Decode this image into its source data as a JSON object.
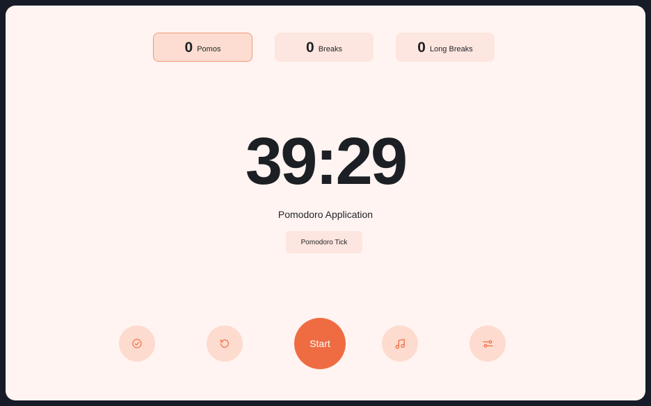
{
  "counters": [
    {
      "count": "0",
      "label": "Pomos"
    },
    {
      "count": "0",
      "label": "Breaks"
    },
    {
      "count": "0",
      "label": "Long Breaks"
    }
  ],
  "active_counter": "Pomos",
  "timer": {
    "display": "39:29",
    "title": "Pomodoro Application",
    "tick_label": "Pomodoro Tick"
  },
  "controls": {
    "start_label": "Start",
    "icons": [
      "check-circle-icon",
      "reset-icon",
      "music-icon",
      "settings-sliders-icon"
    ]
  },
  "colors": {
    "background": "#fff4f1",
    "accent": "#ef6c43",
    "soft_accent": "#fddbcf",
    "text": "#1c1f24"
  }
}
